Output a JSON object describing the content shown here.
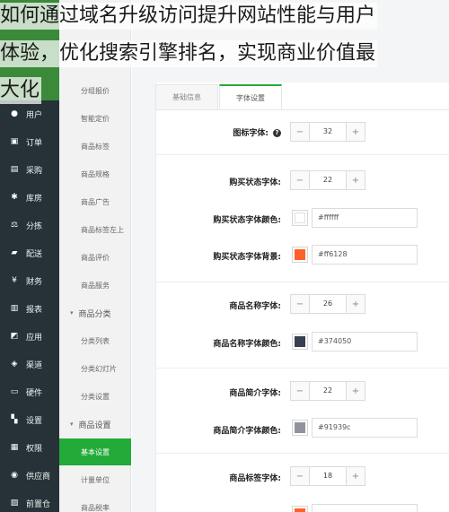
{
  "headline": {
    "line1": "如何通过域名升级访问提升网站性能与用户",
    "line2": "体验，优化搜索引擎排名，实现商业价值最",
    "line3": "大化"
  },
  "sidebar": {
    "items": [
      {
        "label": "用户",
        "icon": "user-icon",
        "glyph": "●"
      },
      {
        "label": "订单",
        "icon": "order-icon",
        "glyph": "▣"
      },
      {
        "label": "采购",
        "icon": "purchase-icon",
        "glyph": "▤"
      },
      {
        "label": "库房",
        "icon": "warehouse-icon",
        "glyph": "✱"
      },
      {
        "label": "分拣",
        "icon": "scale-icon",
        "glyph": "⚖"
      },
      {
        "label": "配送",
        "icon": "truck-icon",
        "glyph": "▰"
      },
      {
        "label": "财务",
        "icon": "yen-icon",
        "glyph": "¥"
      },
      {
        "label": "报表",
        "icon": "chart-icon",
        "glyph": "▥"
      },
      {
        "label": "应用",
        "icon": "apps-icon",
        "glyph": "◩"
      },
      {
        "label": "渠道",
        "icon": "channel-icon",
        "glyph": "◈"
      },
      {
        "label": "硬件",
        "icon": "monitor-icon",
        "glyph": "▭"
      },
      {
        "label": "设置",
        "icon": "settings-icon",
        "glyph": "▚"
      },
      {
        "label": "权限",
        "icon": "bank-icon",
        "glyph": "▦"
      },
      {
        "label": "供应商",
        "icon": "supplier-icon",
        "glyph": "◉"
      },
      {
        "label": "前置仓",
        "icon": "store-icon",
        "glyph": "▨"
      }
    ]
  },
  "submenu": {
    "items": [
      {
        "label": "分组报价"
      },
      {
        "label": "智能定价"
      },
      {
        "label": "商品标签"
      },
      {
        "label": "商品规格"
      },
      {
        "label": "商品广告"
      },
      {
        "label": "商品标签左上"
      },
      {
        "label": "商品评价"
      },
      {
        "label": "商品服务"
      },
      {
        "label": "商品分类",
        "group": true
      },
      {
        "label": "分类列表"
      },
      {
        "label": "分类幻灯片"
      },
      {
        "label": "分类设置"
      },
      {
        "label": "商品设置",
        "group": true
      },
      {
        "label": "基本设置",
        "active": true
      },
      {
        "label": "计量单位"
      },
      {
        "label": "商品税率"
      }
    ]
  },
  "tabs": [
    {
      "label": "基础信息"
    },
    {
      "label": "字体设置",
      "active": true
    }
  ],
  "settings": {
    "icon_font": {
      "label": "图标字体:",
      "value": "32"
    },
    "buy_font": {
      "label": "购买状态字体:",
      "value": "22"
    },
    "buy_font_color": {
      "label": "购买状态字体颜色:",
      "value": "#ffffff",
      "swatch": "#ffffff"
    },
    "buy_font_bg": {
      "label": "购买状态字体背景:",
      "value": "#ff6128",
      "swatch": "#ff6128"
    },
    "name_font": {
      "label": "商品名称字体:",
      "value": "26"
    },
    "name_font_color": {
      "label": "商品名称字体颜色:",
      "value": "#374050",
      "swatch": "#374050"
    },
    "intro_font": {
      "label": "商品简介字体:",
      "value": "22"
    },
    "intro_font_color": {
      "label": "商品简介字体颜色:",
      "value": "#91939c",
      "swatch": "#91939c"
    },
    "tag_font": {
      "label": "商品标签字体:",
      "value": "18"
    }
  },
  "colors": {
    "accent": "#22ab38",
    "sidebar_bg": "#263238"
  }
}
